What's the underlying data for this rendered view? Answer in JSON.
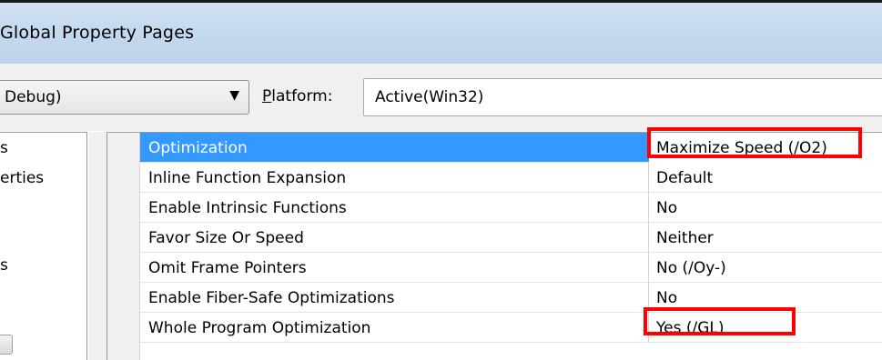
{
  "window": {
    "title": "Global Property Pages"
  },
  "toolbar": {
    "configuration_value": "Debug)",
    "platform_label_prefix": "",
    "platform_label_accel": "P",
    "platform_label_rest": "latform:",
    "platform_value": "Active(Win32)"
  },
  "tree": {
    "items": [
      "s",
      "erties",
      "s"
    ]
  },
  "properties": [
    {
      "name": "Optimization",
      "value": "Maximize Speed (/O2)",
      "selected": true
    },
    {
      "name": "Inline Function Expansion",
      "value": "Default"
    },
    {
      "name": "Enable Intrinsic Functions",
      "value": "No"
    },
    {
      "name": "Favor Size Or Speed",
      "value": "Neither"
    },
    {
      "name": "Omit Frame Pointers",
      "value": "No (/Oy-)"
    },
    {
      "name": "Enable Fiber-Safe Optimizations",
      "value": "No"
    },
    {
      "name": "Whole Program Optimization",
      "value": "Yes (/GL)"
    }
  ],
  "colors": {
    "selection": "#3399ff",
    "annotation": "#ff0000"
  },
  "icons": {
    "dropdown": "chevron-down-icon"
  }
}
